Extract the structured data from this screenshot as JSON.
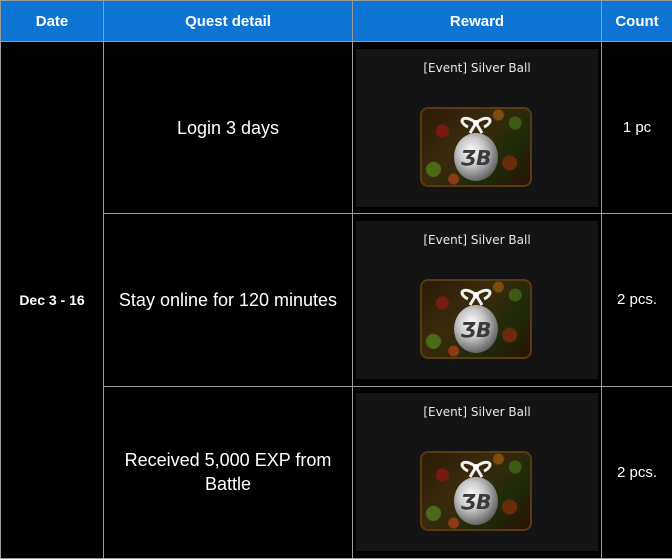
{
  "headers": {
    "date": "Date",
    "quest_detail": "Quest detail",
    "reward": "Reward",
    "count": "Count"
  },
  "date_range": "Dec 3 - 16",
  "rows": [
    {
      "detail": "Login 3 days",
      "reward_name": "[Event] Silver Ball",
      "count": "1 pc"
    },
    {
      "detail": "Stay online for 120 minutes",
      "reward_name": "[Event] Silver Ball",
      "count": "2 pcs."
    },
    {
      "detail": "Received 5,000 EXP from Battle",
      "reward_name": "[Event] Silver Ball",
      "count": "2 pcs."
    }
  ],
  "colors": {
    "header_bg": "#0d74d4",
    "page_bg": "#000000",
    "border": "#9a9a9a"
  },
  "icons": [
    "silver-ball-icon"
  ]
}
